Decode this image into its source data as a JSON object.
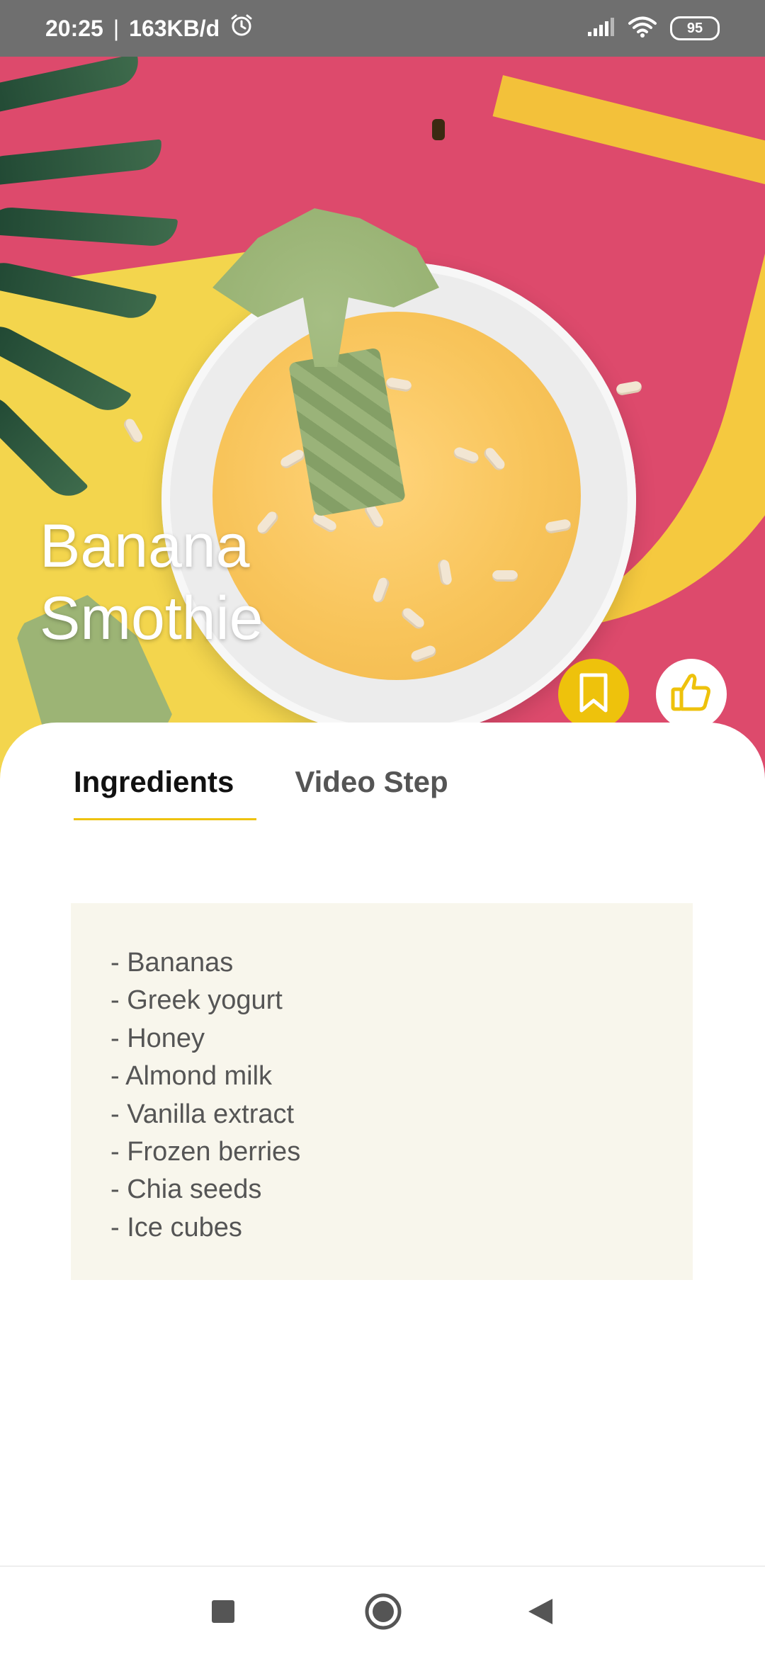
{
  "status_bar": {
    "time": "20:25",
    "separator": "|",
    "data_rate": "163KB/d",
    "battery_level": "95",
    "icons": [
      "alarm-icon",
      "signal-icon",
      "wifi-icon",
      "battery-icon"
    ]
  },
  "hero": {
    "title_line1": "Banana",
    "title_line2": "Smothie",
    "actions": [
      {
        "name": "bookmark",
        "icon": "bookmark-icon",
        "color": "#EEC20C"
      },
      {
        "name": "like",
        "icon": "thumbs-up-icon",
        "color": "#FFFFFF"
      }
    ]
  },
  "tabs": [
    {
      "label": "Ingredients",
      "active": true
    },
    {
      "label": "Video Step",
      "active": false
    }
  ],
  "ingredients": [
    "- Bananas",
    "- Greek yogurt",
    "- Honey",
    "- Almond milk",
    "- Vanilla extract",
    "- Frozen berries",
    "- Chia seeds",
    "- Ice cubes"
  ],
  "nav": {
    "buttons": [
      "recent-apps-icon",
      "home-icon",
      "back-icon"
    ]
  },
  "colors": {
    "accent": "#EEC20C",
    "hero_background": "#DD4A6C",
    "ingredients_background": "#F8F6EC"
  }
}
